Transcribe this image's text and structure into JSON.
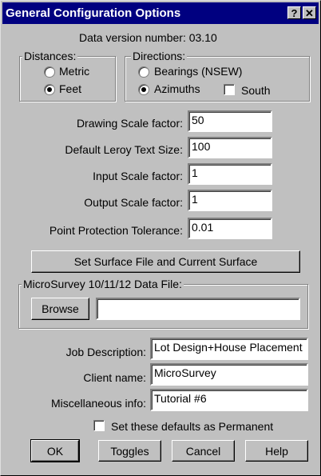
{
  "window": {
    "title": "General Configuration Options",
    "help_glyph": "?",
    "close_glyph": "✕"
  },
  "data_version": "Data version number: 03.10",
  "distances": {
    "legend": "Distances:",
    "options": [
      "Metric",
      "Feet"
    ],
    "selected": "Feet"
  },
  "directions": {
    "legend": "Directions:",
    "options": [
      "Bearings (NSEW)",
      "Azimuths"
    ],
    "selected": "Azimuths",
    "south_label": "South",
    "south_checked": false
  },
  "scale_fields": [
    {
      "label": "Drawing Scale factor:",
      "value": "50"
    },
    {
      "label": "Default Leroy Text Size:",
      "value": "100"
    },
    {
      "label": "Input Scale factor:",
      "value": "1"
    },
    {
      "label": "Output Scale factor:",
      "value": "1"
    },
    {
      "label": "Point Protection Tolerance:",
      "value": "0.01"
    }
  ],
  "surface_button": "Set Surface File and Current Surface",
  "microsurvey": {
    "legend": "MicroSurvey 10/11/12 Data File:",
    "browse_label": "Browse",
    "file_value": ""
  },
  "job_fields": [
    {
      "label": "Job Description:",
      "value": "Lot Design+House Placement"
    },
    {
      "label": "Client name:",
      "value": "MicroSurvey"
    },
    {
      "label": "Miscellaneous info:",
      "value": "Tutorial #6"
    }
  ],
  "permanent": {
    "label": "Set these defaults as Permanent",
    "checked": false
  },
  "buttons": {
    "ok": "OK",
    "toggles": "Toggles",
    "cancel": "Cancel",
    "help": "Help"
  }
}
